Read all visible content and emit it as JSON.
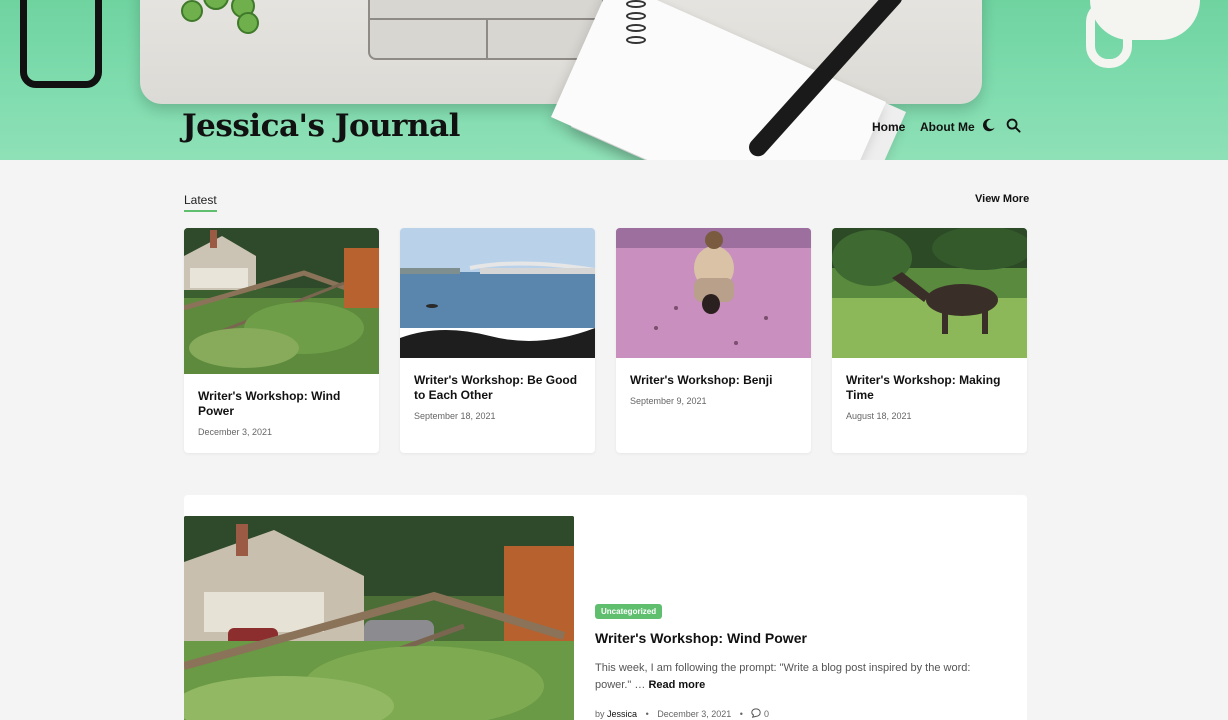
{
  "header": {
    "site_title": "Jessica's Journal",
    "nav": {
      "home": "Home",
      "about": "About Me",
      "theme_icon": "moon-icon",
      "search_icon": "search-icon"
    },
    "accent_color": "#7fdcae"
  },
  "latest": {
    "label": "Latest",
    "view_more": "View More",
    "cards": [
      {
        "title": "Writer's Workshop: Wind Power",
        "date": "December 3, 2021"
      },
      {
        "title": "Writer's Workshop: Be Good to Each Other",
        "date": "September 18, 2021"
      },
      {
        "title": "Writer's Workshop: Benji",
        "date": "September 9, 2021"
      },
      {
        "title": "Writer's Workshop: Making Time",
        "date": "August 18, 2021"
      }
    ]
  },
  "featured": {
    "category": "Uncategorized",
    "title": "Writer's Workshop: Wind Power",
    "excerpt": "This week, I am following the prompt: \"Write a blog post inspired by the word: power.\" …",
    "read_more": "Read more",
    "by": "by",
    "author": "Jessica",
    "date": "December 3, 2021",
    "comments": "0",
    "badge_color": "#5fbf6f"
  }
}
